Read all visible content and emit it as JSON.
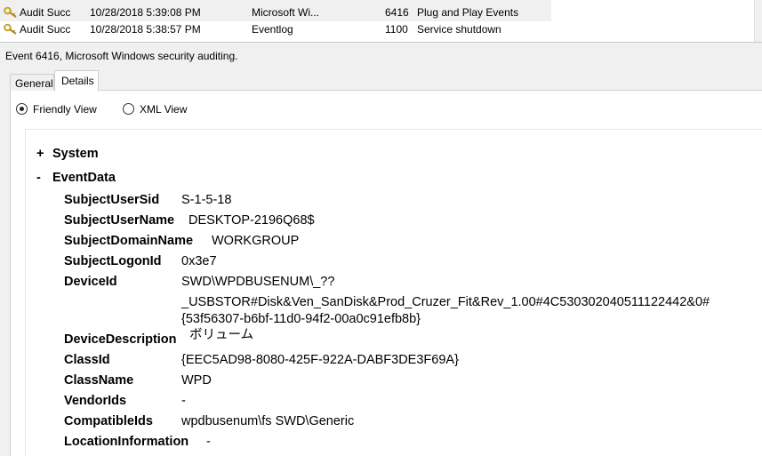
{
  "event_list": {
    "rows": [
      {
        "keywords": "Audit Succ",
        "date_time": "10/28/2018 5:39:08 PM",
        "source": "Microsoft Wi...",
        "event_id": "6416",
        "task_category": "Plug and Play Events",
        "icon": "key-icon"
      },
      {
        "keywords": "Audit Succ",
        "date_time": "10/28/2018 5:38:57 PM",
        "source": "Eventlog",
        "event_id": "1100",
        "task_category": "Service shutdown",
        "icon": "key-icon"
      }
    ]
  },
  "details": {
    "title": "Event 6416, Microsoft Windows security auditing.",
    "tabs": [
      {
        "label": "General",
        "selected": false
      },
      {
        "label": "Details",
        "selected": true
      }
    ],
    "view_options": [
      {
        "label": "Friendly View",
        "selected": true
      },
      {
        "label": "XML View",
        "selected": false
      }
    ],
    "sections": {
      "system": {
        "toggle": "+",
        "label": "System"
      },
      "event_data": {
        "toggle": "-",
        "label": "EventData"
      }
    },
    "fields": {
      "subject_user_sid": {
        "name": "SubjectUserSid",
        "value": "S-1-5-18"
      },
      "subject_user_name": {
        "name": "SubjectUserName",
        "value": "DESKTOP-2196Q68$"
      },
      "subject_domain_name": {
        "name": "SubjectDomainName",
        "value": "WORKGROUP"
      },
      "subject_logon_id": {
        "name": "SubjectLogonId",
        "value": "0x3e7"
      },
      "device_id": {
        "name": "DeviceId",
        "value_lines": [
          "SWD\\WPDBUSENUM\\_??",
          "_USBSTOR#Disk&Ven_SanDisk&Prod_Cruzer_Fit&Rev_1.00#4C530302040511122442&0#",
          "{53f56307-b6bf-11d0-94f2-00a0c91efb8b}"
        ]
      },
      "device_description": {
        "name": "DeviceDescription",
        "value": "ボリューム"
      },
      "class_id": {
        "name": "ClassId",
        "value": "{EEC5AD98-8080-425F-922A-DABF3DE3F69A}"
      },
      "class_name": {
        "name": "ClassName",
        "value": "WPD"
      },
      "vendor_ids": {
        "name": "VendorIds",
        "value": "-"
      },
      "compatible_ids": {
        "name": "CompatibleIds",
        "value": "wpdbusenum\\fs SWD\\Generic"
      },
      "location_information": {
        "name": "LocationInformation",
        "value": "-"
      }
    }
  },
  "colors": {
    "row_selected_bg": "#f0f0f0",
    "panel_bg": "#f0f0f0",
    "content_bg": "#ffffff",
    "key_icon": "#c9a227"
  }
}
